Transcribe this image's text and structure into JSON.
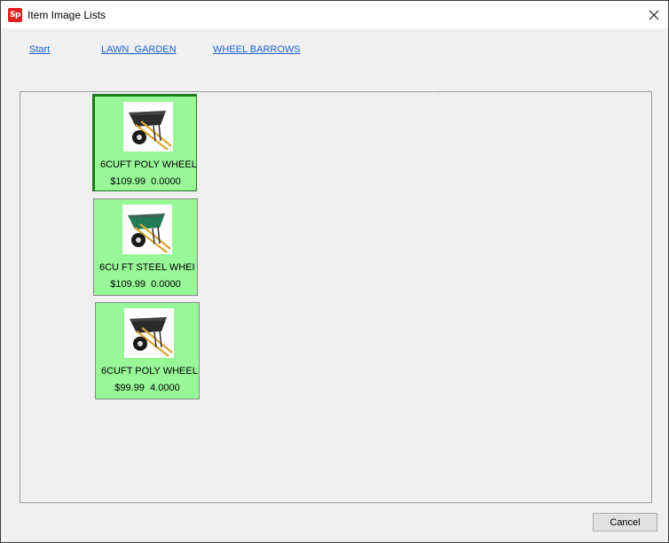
{
  "window": {
    "title": "Item Image Lists",
    "app_icon_text": "Sp",
    "accent": "#e02020"
  },
  "breadcrumbs": [
    {
      "label": "Start"
    },
    {
      "label": "LAWN_GARDEN"
    },
    {
      "label": "WHEEL BARROWS"
    }
  ],
  "items": [
    {
      "name": "6CUFT POLY WHEEL",
      "price": "$109.99",
      "qty": "0.0000",
      "tray_color": "#2b2b2b",
      "selected": true
    },
    {
      "name": "6CU FT STEEL WHEI",
      "price": "$109.99",
      "qty": "0.0000",
      "tray_color": "#1f7a55",
      "selected": false
    },
    {
      "name": "6CUFT POLY WHEEL",
      "price": "$99.99",
      "qty": "4.0000",
      "tray_color": "#2b2b2b",
      "selected": false
    }
  ],
  "footer": {
    "cancel_label": "Cancel"
  },
  "colors": {
    "tile_bg": "#98f898",
    "tile_selected_border": "#1b7a1b",
    "link": "#1a5fd0"
  }
}
